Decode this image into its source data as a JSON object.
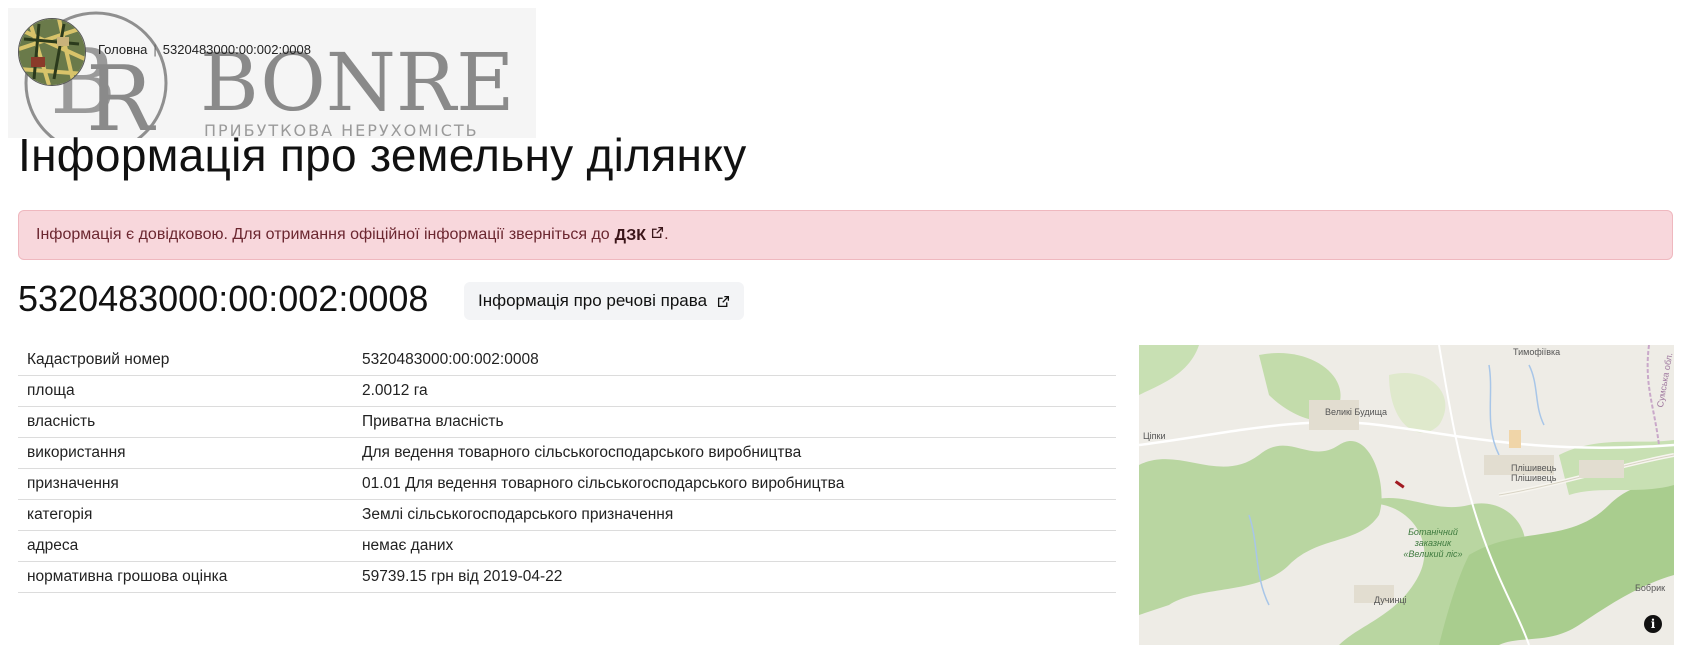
{
  "watermark": {
    "brand": "BONRE",
    "tagline": "ПРИБУТКОВА НЕРУХОМІСТЬ"
  },
  "breadcrumb": {
    "home": "Головна",
    "current": "5320483000:00:002:0008"
  },
  "page_title": "Інформація про земельну ділянку",
  "alert": {
    "text": "Інформація є довідковою. Для отримання офіційної інформації зверніться до",
    "link": "ДЗК",
    "end": "."
  },
  "cadastral_title": "5320483000:00:002:0008",
  "rights_button": "Інформація про речові права",
  "table": {
    "rows": [
      {
        "key": "Кадастровий номер",
        "value": "5320483000:00:002:0008"
      },
      {
        "key": "площа",
        "value": "2.0012 га"
      },
      {
        "key": "власність",
        "value": "Приватна власність"
      },
      {
        "key": "використання",
        "value": "Для ведення товарного сільськогосподарського виробництва"
      },
      {
        "key": "призначення",
        "value": "01.01 Для ведення товарного сільськогосподарського виробництва"
      },
      {
        "key": "категорія",
        "value": "Землі сільськогосподарського призначення"
      },
      {
        "key": "адреса",
        "value": "немає даних"
      },
      {
        "key": "нормативна грошова оцінка",
        "value": "59739.15 грн від 2019-04-22"
      }
    ]
  },
  "map": {
    "labels": {
      "timofiivka": "Тимофіївка",
      "veliki_budyshcha": "Великі Будища",
      "tsipky": "Ціпки",
      "plishyvets": "Плішивець",
      "plishyvets2": "Плішивець",
      "zakaznyk": "Ботанічний заказник «Великий ліс»",
      "duchyntsi": "Дучинці",
      "bobryk": "Бобрик",
      "oblast": "Сумська обл."
    },
    "info_glyph": "i",
    "colors": {
      "forest": "#b9d6a1",
      "land": "#eeece6",
      "parcel": "#a11a22"
    }
  }
}
